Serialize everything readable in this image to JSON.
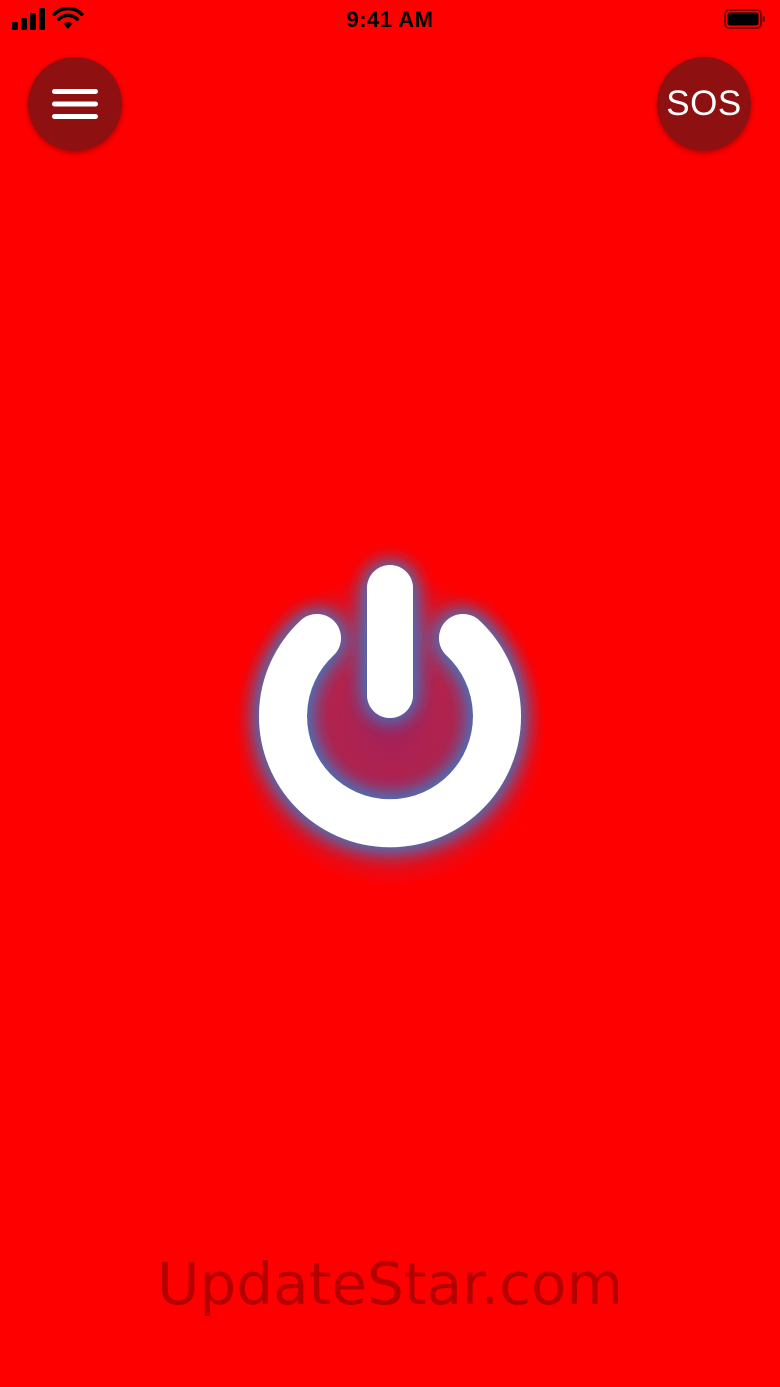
{
  "status_bar": {
    "time": "9:41 AM",
    "icons": [
      "signal-icon",
      "wifi-icon",
      "battery-icon"
    ]
  },
  "header": {
    "menu_icon": "hamburger-menu-icon",
    "sos_label": "SOS"
  },
  "main": {
    "power_icon": "power-icon",
    "state": "off"
  },
  "watermark": {
    "text": "UpdateStar.com"
  },
  "colors": {
    "background": "#ff0000",
    "button_fill": "#8e1010",
    "icon_white": "#ffffff",
    "glow_blue": "#3a7cc8",
    "status_text": "#000000"
  }
}
